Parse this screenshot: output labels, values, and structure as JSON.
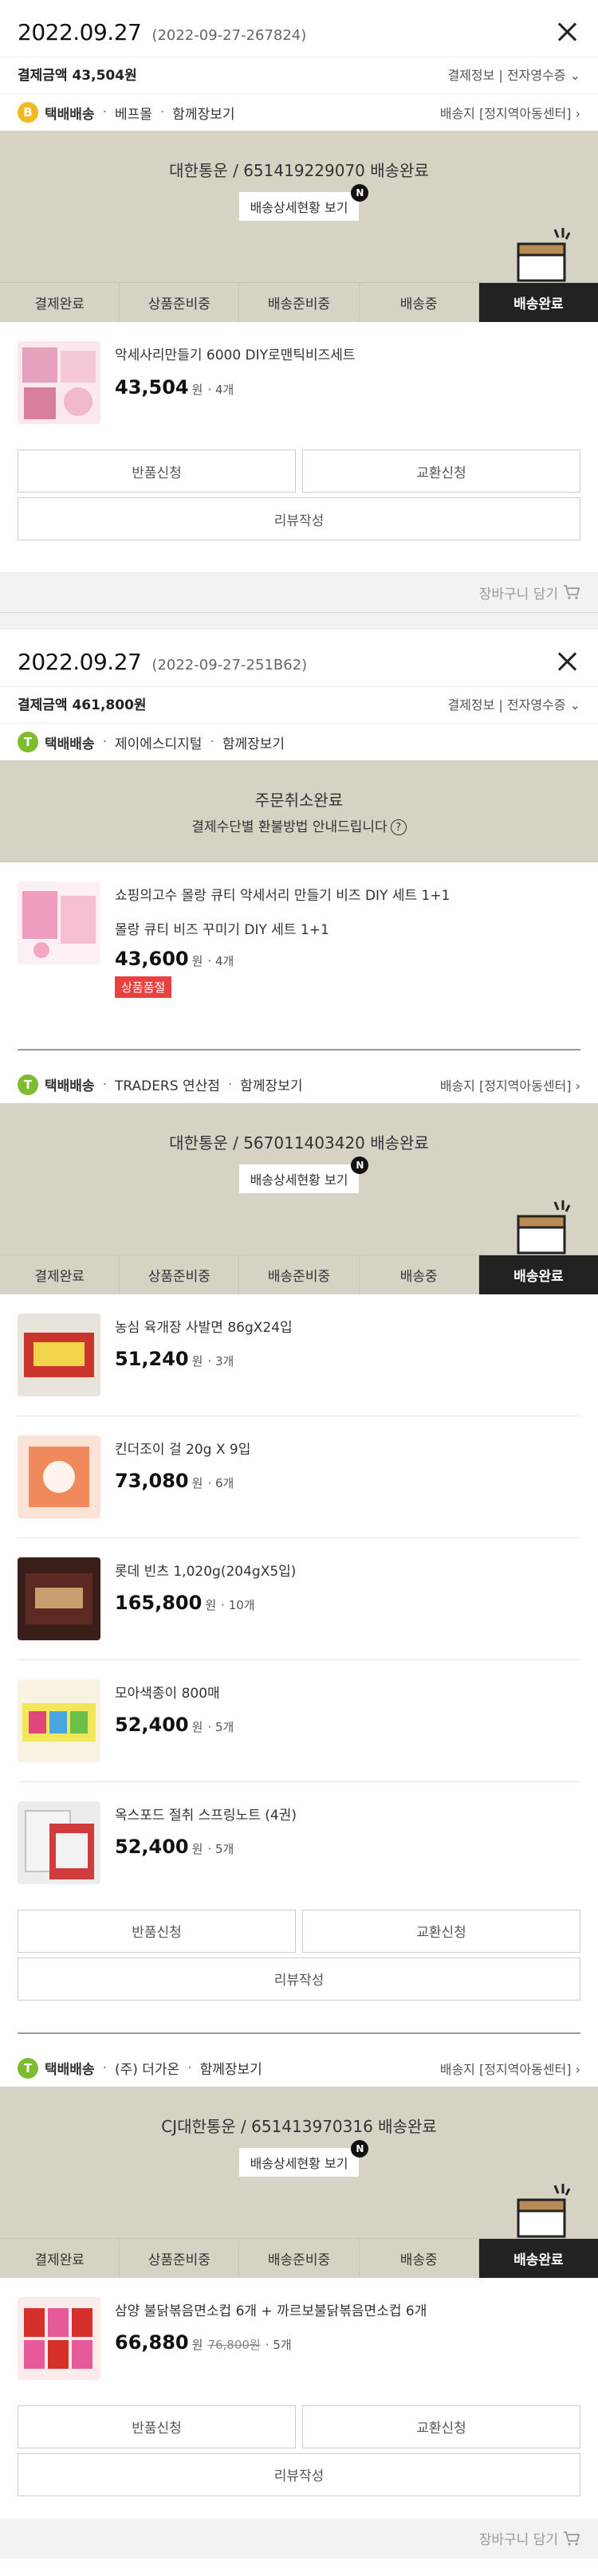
{
  "orders": [
    {
      "date": "2022.09.27",
      "order_no": "(2022-09-27-267824)",
      "pay_label": "결제금액 43,504원",
      "pay_info_link": "결제정보",
      "receipt_link": "전자영수증",
      "shipments": [
        {
          "type": "택배배송",
          "badge": "B",
          "seller": "베프몰",
          "together": "함께장보기",
          "address": "배송지 [정지역아동센터]",
          "carrier_status": "대한통운 / 651419229070 배송완료",
          "track_btn": "배송상세현황 보기",
          "products": [
            {
              "name": "악세사리만들기 6000 DIY로맨틱비즈세트",
              "price": "43,504",
              "won": "원",
              "qty": "4개"
            }
          ],
          "buttons": {
            "return": "반품신청",
            "exchange": "교환신청",
            "review": "리뷰작성"
          }
        }
      ],
      "cart_label": "장바구니 담기"
    },
    {
      "date": "2022.09.27",
      "order_no": "(2022-09-27-251B62)",
      "pay_label": "결제금액 461,800원",
      "pay_info_link": "결제정보",
      "receipt_link": "전자영수증",
      "shipments": [
        {
          "type": "택배배송",
          "badge": "T",
          "seller": "제이에스디지털",
          "together": "함께장보기",
          "cancel_title": "주문취소완료",
          "cancel_sub": "결제수단별 환불방법 안내드립니다",
          "products": [
            {
              "name": "쇼핑의고수 몰랑 큐티 악세서리 만들기 비즈 DIY 세트 1+1",
              "option": "몰랑 큐티 비즈 꾸미기 DIY 세트 1+1",
              "price": "43,600",
              "won": "원",
              "qty": "4개",
              "soldout": "상품품절"
            }
          ]
        },
        {
          "type": "택배배송",
          "badge": "T",
          "seller": "TRADERS 연산점",
          "together": "함께장보기",
          "address": "배송지 [정지역아동센터]",
          "carrier_status": "대한통운 / 567011403420 배송완료",
          "track_btn": "배송상세현황 보기",
          "products": [
            {
              "name": "농심 육개장 사발면 86gX24입",
              "price": "51,240",
              "won": "원",
              "qty": "3개"
            },
            {
              "name": "킨더조이 걸 20g X 9입",
              "price": "73,080",
              "won": "원",
              "qty": "6개"
            },
            {
              "name": "롯데 빈츠 1,020g(204gX5입)",
              "price": "165,800",
              "won": "원",
              "qty": "10개"
            },
            {
              "name": "모아색종이 800매",
              "price": "52,400",
              "won": "원",
              "qty": "5개"
            },
            {
              "name": "옥스포드 절취 스프링노트 (4권)",
              "price": "52,400",
              "won": "원",
              "qty": "5개"
            }
          ],
          "buttons": {
            "return": "반품신청",
            "exchange": "교환신청",
            "review": "리뷰작성"
          }
        },
        {
          "type": "택배배송",
          "badge": "T",
          "seller": "(주) 더가온",
          "together": "함께장보기",
          "address": "배송지 [정지역아동센터]",
          "carrier_status": "CJ대한통운 / 651413970316 배송완료",
          "track_btn": "배송상세현황 보기",
          "products": [
            {
              "name": "삼양 불닭볶음면소컵 6개 + 까르보불닭볶음면소컵 6개",
              "price": "66,880",
              "won": "원",
              "orig_price": "76,800원",
              "qty": "5개"
            }
          ],
          "buttons": {
            "return": "반품신청",
            "exchange": "교환신청",
            "review": "리뷰작성"
          }
        }
      ],
      "cart_label": "장바구니 담기"
    }
  ],
  "steps": [
    "결제완료",
    "상품준비중",
    "배송준비중",
    "배송중",
    "배송완료"
  ],
  "track_new_badge": "N",
  "theme": {
    "panel": "#d6d2c4",
    "active_step": "#222222",
    "soldout": "#e94040",
    "badge_b": "#f0b91f",
    "badge_t": "#7dbb2f"
  }
}
